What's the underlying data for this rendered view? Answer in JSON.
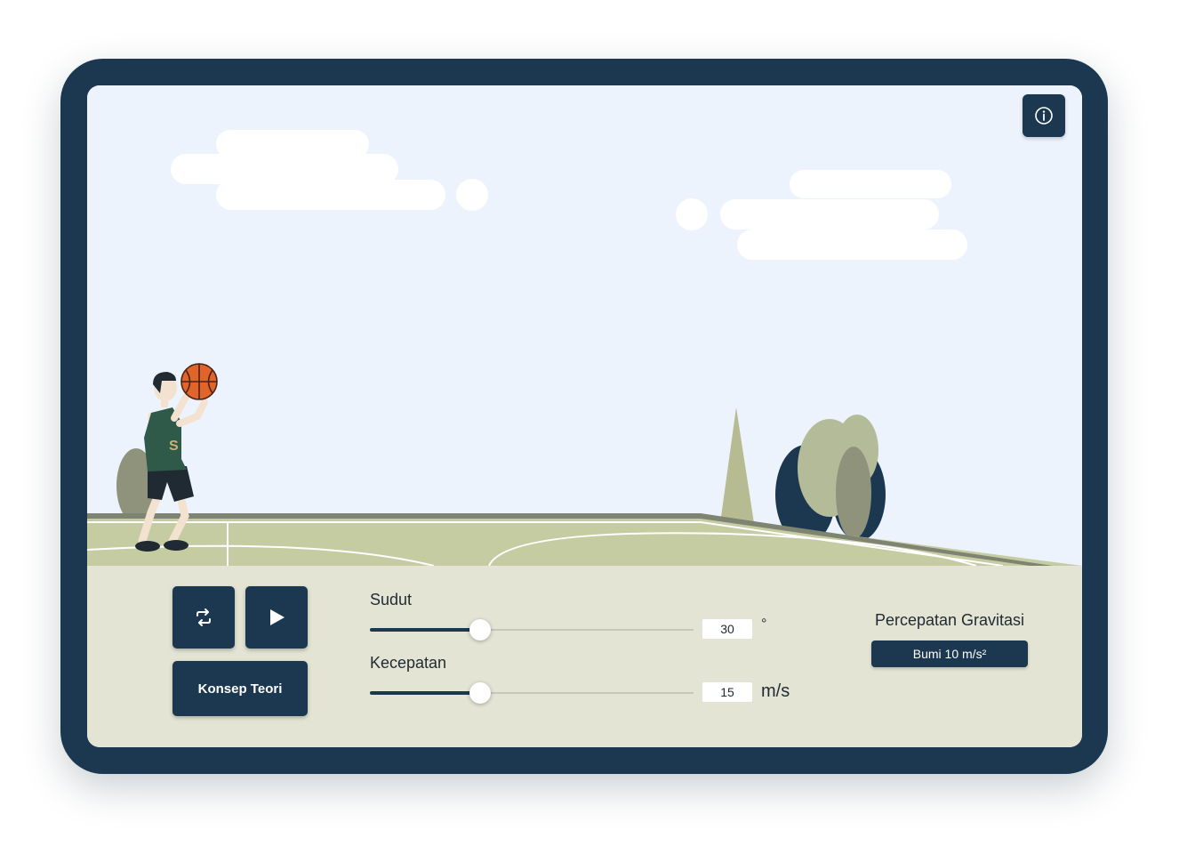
{
  "controls": {
    "reset_icon": "repeat-icon",
    "play_icon": "play-icon",
    "konsep_label": "Konsep Teori",
    "info_icon": "info-icon"
  },
  "angle": {
    "label": "Sudut",
    "value": "30",
    "unit": "°",
    "slider_fraction": 0.34
  },
  "speed": {
    "label": "Kecepatan",
    "value": "15",
    "unit": "m/s",
    "slider_fraction": 0.34
  },
  "gravity": {
    "label": "Percepatan Gravitasi",
    "value": "Bumi 10 m/s²"
  },
  "colors": {
    "frame": "#1b3850",
    "sky": "#edf3fd",
    "court": "#c6cca2",
    "panel": "#e3e4d3",
    "ball": "#e1642a"
  }
}
